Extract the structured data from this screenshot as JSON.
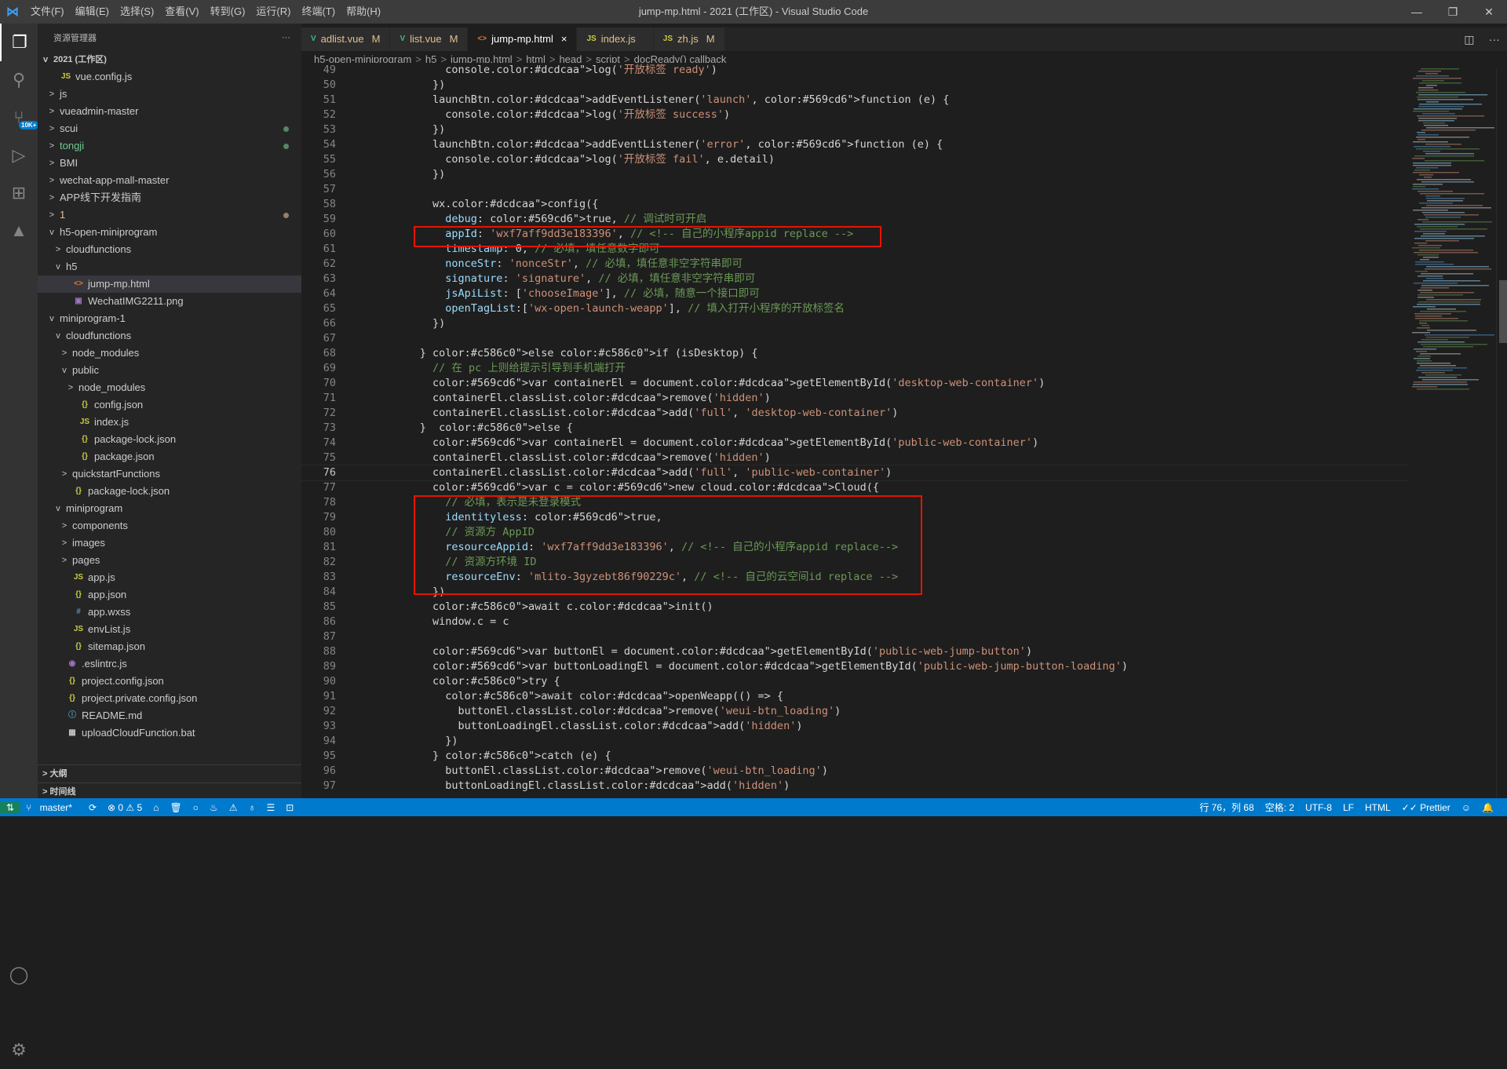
{
  "titlebar": {
    "menu": [
      "文件(F)",
      "编辑(E)",
      "选择(S)",
      "查看(V)",
      "转到(G)",
      "运行(R)",
      "终端(T)",
      "帮助(H)"
    ],
    "title": "jump-mp.html - 2021 (工作区) - Visual Studio Code"
  },
  "activity": {
    "badge": "10K+"
  },
  "sidebar": {
    "header": "资源管理器",
    "workspace": "2021 (工作区)",
    "items": [
      {
        "label": "vue.config.js",
        "indent": 1,
        "icon": "JS",
        "chev": ""
      },
      {
        "label": "js",
        "indent": 1,
        "chev": ">"
      },
      {
        "label": "vueadmin-master",
        "indent": 1,
        "chev": ">"
      },
      {
        "label": "scui",
        "indent": 1,
        "chev": ">",
        "dot": true
      },
      {
        "label": "tongji",
        "indent": 1,
        "chev": ">",
        "dot": true,
        "state": "green"
      },
      {
        "label": "BMI",
        "indent": 1,
        "chev": ">"
      },
      {
        "label": "wechat-app-mall-master",
        "indent": 1,
        "chev": ">"
      },
      {
        "label": "APP线下开发指南",
        "indent": 1,
        "chev": ">"
      },
      {
        "label": "1",
        "indent": 1,
        "chev": ">",
        "dot": true,
        "state": "mod"
      },
      {
        "label": "h5-open-miniprogram",
        "indent": 1,
        "chev": "v"
      },
      {
        "label": "cloudfunctions",
        "indent": 2,
        "chev": ">"
      },
      {
        "label": "h5",
        "indent": 2,
        "chev": "v"
      },
      {
        "label": "jump-mp.html",
        "indent": 3,
        "icon": "<>",
        "chev": "",
        "selected": true
      },
      {
        "label": "WechatIMG2211.png",
        "indent": 3,
        "icon": "▣",
        "chev": ""
      },
      {
        "label": "miniprogram-1",
        "indent": 1,
        "chev": "v"
      },
      {
        "label": "cloudfunctions",
        "indent": 2,
        "chev": "v"
      },
      {
        "label": "node_modules",
        "indent": 3,
        "chev": ">"
      },
      {
        "label": "public",
        "indent": 3,
        "chev": "v"
      },
      {
        "label": "node_modules",
        "indent": 4,
        "chev": ">"
      },
      {
        "label": "config.json",
        "indent": 4,
        "icon": "{}",
        "chev": ""
      },
      {
        "label": "index.js",
        "indent": 4,
        "icon": "JS",
        "chev": ""
      },
      {
        "label": "package-lock.json",
        "indent": 4,
        "icon": "{}",
        "chev": ""
      },
      {
        "label": "package.json",
        "indent": 4,
        "icon": "{}",
        "chev": ""
      },
      {
        "label": "quickstartFunctions",
        "indent": 3,
        "chev": ">"
      },
      {
        "label": "package-lock.json",
        "indent": 3,
        "icon": "{}",
        "chev": ""
      },
      {
        "label": "miniprogram",
        "indent": 2,
        "chev": "v"
      },
      {
        "label": "components",
        "indent": 3,
        "chev": ">"
      },
      {
        "label": "images",
        "indent": 3,
        "chev": ">"
      },
      {
        "label": "pages",
        "indent": 3,
        "chev": ">"
      },
      {
        "label": "app.js",
        "indent": 3,
        "icon": "JS",
        "chev": ""
      },
      {
        "label": "app.json",
        "indent": 3,
        "icon": "{}",
        "chev": ""
      },
      {
        "label": "app.wxss",
        "indent": 3,
        "icon": "#",
        "chev": ""
      },
      {
        "label": "envList.js",
        "indent": 3,
        "icon": "JS",
        "chev": ""
      },
      {
        "label": "sitemap.json",
        "indent": 3,
        "icon": "{}",
        "chev": ""
      },
      {
        "label": ".eslintrc.js",
        "indent": 2,
        "icon": "◉",
        "chev": ""
      },
      {
        "label": "project.config.json",
        "indent": 2,
        "icon": "{}",
        "chev": ""
      },
      {
        "label": "project.private.config.json",
        "indent": 2,
        "icon": "{}",
        "chev": ""
      },
      {
        "label": "README.md",
        "indent": 2,
        "icon": "ⓘ",
        "chev": ""
      },
      {
        "label": "uploadCloudFunction.bat",
        "indent": 2,
        "icon": "▦",
        "chev": ""
      }
    ],
    "outline": "大纲",
    "timeline": "时间线"
  },
  "tabs": [
    {
      "label": "adlist.vue",
      "icon": "V",
      "mod": "M",
      "active": false,
      "iconColor": "#41b883"
    },
    {
      "label": "list.vue",
      "icon": "V",
      "mod": "M",
      "active": false,
      "iconColor": "#41b883"
    },
    {
      "label": "jump-mp.html",
      "icon": "<>",
      "mod": "×",
      "active": true,
      "iconColor": "#e37933"
    },
    {
      "label": "index.js",
      "icon": "JS",
      "mod": "",
      "active": false,
      "iconColor": "#cbcb41"
    },
    {
      "label": "zh.js",
      "icon": "JS",
      "mod": "M",
      "active": false,
      "iconColor": "#cbcb41"
    }
  ],
  "breadcrumb": [
    "h5-open-miniprogram",
    "h5",
    "jump-mp.html",
    "html",
    "head",
    "script",
    "docReady() callback"
  ],
  "editor": {
    "current_line": 76,
    "lines": [
      {
        "n": 49,
        "t": "          console.log('开放标签 ready')"
      },
      {
        "n": 50,
        "t": "        })"
      },
      {
        "n": 51,
        "t": "        launchBtn.addEventListener('launch', function (e) {"
      },
      {
        "n": 52,
        "t": "          console.log('开放标签 success')"
      },
      {
        "n": 53,
        "t": "        })"
      },
      {
        "n": 54,
        "t": "        launchBtn.addEventListener('error', function (e) {"
      },
      {
        "n": 55,
        "t": "          console.log('开放标签 fail', e.detail)"
      },
      {
        "n": 56,
        "t": "        })"
      },
      {
        "n": 57,
        "t": ""
      },
      {
        "n": 58,
        "t": "        wx.config({"
      },
      {
        "n": 59,
        "t": "          debug: true, // 调试时可开启"
      },
      {
        "n": 60,
        "t": "          appId: 'wxf7aff9dd3e183396', // <!-- 自己的小程序appid replace -->"
      },
      {
        "n": 61,
        "t": "          timestamp: 0, // 必填，填任意数字即可"
      },
      {
        "n": 62,
        "t": "          nonceStr: 'nonceStr', // 必填，填任意非空字符串即可"
      },
      {
        "n": 63,
        "t": "          signature: 'signature', // 必填，填任意非空字符串即可"
      },
      {
        "n": 64,
        "t": "          jsApiList: ['chooseImage'], // 必填，随意一个接口即可"
      },
      {
        "n": 65,
        "t": "          openTagList:['wx-open-launch-weapp'], // 填入打开小程序的开放标签名"
      },
      {
        "n": 66,
        "t": "        })"
      },
      {
        "n": 67,
        "t": ""
      },
      {
        "n": 68,
        "t": "      } else if (isDesktop) {"
      },
      {
        "n": 69,
        "t": "        // 在 pc 上则给提示引导到手机端打开"
      },
      {
        "n": 70,
        "t": "        var containerEl = document.getElementById('desktop-web-container')"
      },
      {
        "n": 71,
        "t": "        containerEl.classList.remove('hidden')"
      },
      {
        "n": 72,
        "t": "        containerEl.classList.add('full', 'desktop-web-container')"
      },
      {
        "n": 73,
        "t": "      }  else {"
      },
      {
        "n": 74,
        "t": "        var containerEl = document.getElementById('public-web-container')"
      },
      {
        "n": 75,
        "t": "        containerEl.classList.remove('hidden')"
      },
      {
        "n": 76,
        "t": "        containerEl.classList.add('full', 'public-web-container')"
      },
      {
        "n": 77,
        "t": "        var c = new cloud.Cloud({"
      },
      {
        "n": 78,
        "t": "          // 必填，表示是未登录模式"
      },
      {
        "n": 79,
        "t": "          identityless: true,"
      },
      {
        "n": 80,
        "t": "          // 资源方 AppID"
      },
      {
        "n": 81,
        "t": "          resourceAppid: 'wxf7aff9dd3e183396', // <!-- 自己的小程序appid replace-->"
      },
      {
        "n": 82,
        "t": "          // 资源方环境 ID"
      },
      {
        "n": 83,
        "t": "          resourceEnv: 'mlito-3gyzebt86f90229c', // <!-- 自己的云空间id replace -->"
      },
      {
        "n": 84,
        "t": "        })"
      },
      {
        "n": 85,
        "t": "        await c.init()"
      },
      {
        "n": 86,
        "t": "        window.c = c"
      },
      {
        "n": 87,
        "t": ""
      },
      {
        "n": 88,
        "t": "        var buttonEl = document.getElementById('public-web-jump-button')"
      },
      {
        "n": 89,
        "t": "        var buttonLoadingEl = document.getElementById('public-web-jump-button-loading')"
      },
      {
        "n": 90,
        "t": "        try {"
      },
      {
        "n": 91,
        "t": "          await openWeapp(() => {"
      },
      {
        "n": 92,
        "t": "            buttonEl.classList.remove('weui-btn_loading')"
      },
      {
        "n": 93,
        "t": "            buttonLoadingEl.classList.add('hidden')"
      },
      {
        "n": 94,
        "t": "          })"
      },
      {
        "n": 95,
        "t": "        } catch (e) {"
      },
      {
        "n": 96,
        "t": "          buttonEl.classList.remove('weui-btn_loading')"
      },
      {
        "n": 97,
        "t": "          buttonLoadingEl.classList.add('hidden')"
      }
    ]
  },
  "statusbar": {
    "branch": "master*",
    "problems": "⊗ 0 ⚠ 5",
    "cursor": "行 76，列 68",
    "spaces": "空格: 2",
    "encoding": "UTF-8",
    "eol": "LF",
    "language": "HTML",
    "formatter": "✓✓ Prettier"
  },
  "colors": {
    "accent": "#007acc",
    "highlight_box": "#e51400"
  }
}
